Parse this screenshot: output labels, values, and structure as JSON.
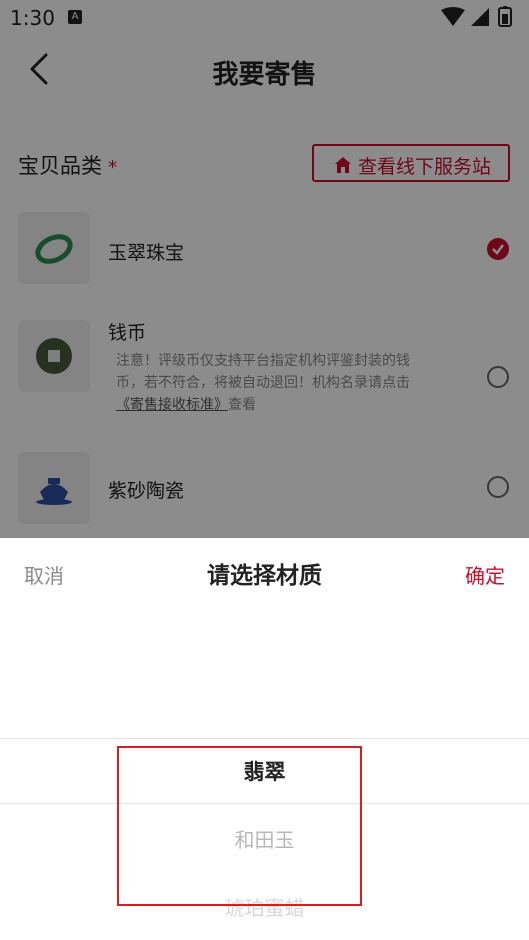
{
  "status_bar": {
    "time": "1:30",
    "notification_badge": "A"
  },
  "header": {
    "title": "我要寄售"
  },
  "category_section": {
    "label": "宝贝品类",
    "required_mark": "*"
  },
  "service_station_button": {
    "label": "查看线下服务站"
  },
  "categories": [
    {
      "name": "玉翠珠宝",
      "selected": true
    },
    {
      "name": "钱币",
      "selected": false,
      "note_line1": "注意！评级币仅支持平台指定机构评鉴封装的钱",
      "note_line2": "币，若不符合，将被自动退回！机构名录请点击",
      "note_link": "《寄售接收标准》",
      "note_suffix": "查看"
    },
    {
      "name": "紫砂陶瓷",
      "selected": false
    }
  ],
  "picker": {
    "cancel_label": "取消",
    "title": "请选择材质",
    "confirm_label": "确定",
    "options": [
      "翡翠",
      "和田玉",
      "琥珀蜜蜡"
    ],
    "selected": "翡翠"
  },
  "colors": {
    "accent": "#c8102e",
    "overlay": "rgba(0,0,0,0.45)"
  }
}
